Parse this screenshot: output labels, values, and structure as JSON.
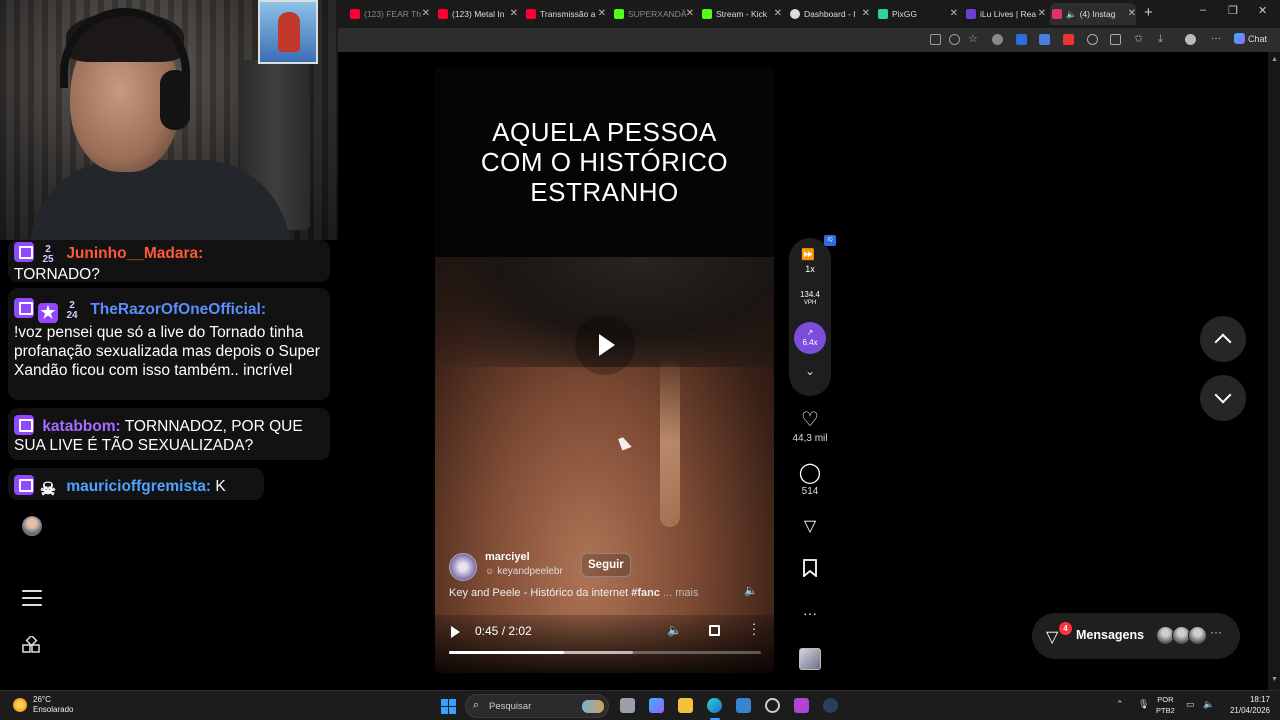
{
  "chat": {
    "messages": [
      {
        "user": "Juninho__Madara:",
        "user_color": "#ff5a36",
        "sub_badge": "2\n25",
        "text": "TORNADO?"
      },
      {
        "user": "TheRazorOfOneOfficial:",
        "user_color": "#5c8dff",
        "sub_badge": "2\n24",
        "text": "!voz pensei que só a live do Tornado tinha profanação sexualizada mas depois o Super Xandão ficou com isso também.. incrível"
      },
      {
        "user": "katabbom:",
        "user_color": "#a56cff",
        "text": "TORNNADOZ, POR QUE SUA LIVE É TÃO SEXUALIZADA?"
      },
      {
        "user": "mauricioffgremista:",
        "user_color": "#4fa3ff",
        "text": "K"
      }
    ]
  },
  "browser": {
    "tabs": [
      {
        "title": "(123) FEAR Th",
        "icon_color": "#ff0033",
        "dim": true
      },
      {
        "title": "(123) Metal In",
        "icon_color": "#ff0033"
      },
      {
        "title": "Transmissão a",
        "icon_color": "#ff0033"
      },
      {
        "title": "SUPERXANDÃ",
        "icon_color": "#53fc18",
        "dim": true
      },
      {
        "title": "Stream - Kick",
        "icon_color": "#53fc18"
      },
      {
        "title": "Dashboard - I",
        "icon_color": "#dddddd"
      },
      {
        "title": "PixGG",
        "icon_color": "#2fd0a0"
      },
      {
        "title": "iLu Lives | Rea",
        "icon_color": "#6b3fd6"
      },
      {
        "title": "(4) Instag",
        "icon_color": "#e1306c",
        "active": true
      }
    ],
    "chat_button": "Chat"
  },
  "reel": {
    "title_lines": [
      "AQUELA PESSOA",
      "COM O HISTÓRICO",
      "ESTRANHO"
    ],
    "author": "marciyel",
    "collab": "keyandpeelebr",
    "follow": "Seguir",
    "caption": "Key and Peele - Histórico da internet ",
    "caption_tag": "#fanc",
    "caption_more": "... mais",
    "time": "0:45 / 2:02",
    "progress": 0.37,
    "buffered": 0.59
  },
  "side": {
    "speed": "1x",
    "vph_value": "134.4",
    "vph_unit": "VPH",
    "growth": "6.4x",
    "likes": "44,3 mil",
    "comments": "514"
  },
  "messages_bar": {
    "label": "Mensagens",
    "count": "4"
  },
  "taskbar": {
    "temp": "26°C",
    "weather": "Ensolarado",
    "search": "Pesquisar",
    "lang_top": "POR",
    "lang_bottom": "PTB2",
    "time": "18:17",
    "date": "21/04/2026"
  }
}
